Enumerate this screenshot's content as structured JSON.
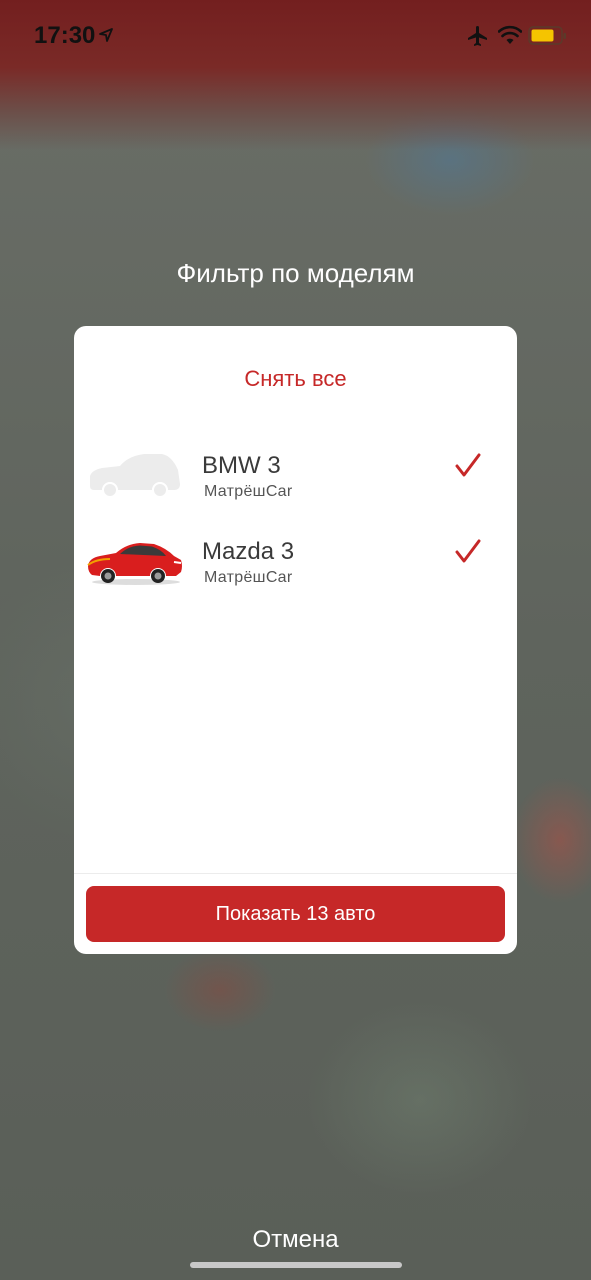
{
  "status_bar": {
    "time": "17:30",
    "icons": [
      "location-arrow-icon",
      "airplane-icon",
      "wifi-icon",
      "battery-icon"
    ],
    "battery_color": "#f5c400"
  },
  "title": "Фильтр по моделям",
  "deselect_all": "Снять все",
  "models": [
    {
      "name": "BMW 3",
      "provider": "МатрёшCar",
      "checked": true,
      "image": "car-placeholder-icon"
    },
    {
      "name": "Mazda 3",
      "provider": "МатрёшCar",
      "checked": true,
      "image": "red-car-image"
    }
  ],
  "show_button": "Показать 13 авто",
  "cancel": "Отмена",
  "colors": {
    "accent": "#c62828",
    "card_bg": "#ffffff",
    "text_primary": "#3a3a3a"
  }
}
